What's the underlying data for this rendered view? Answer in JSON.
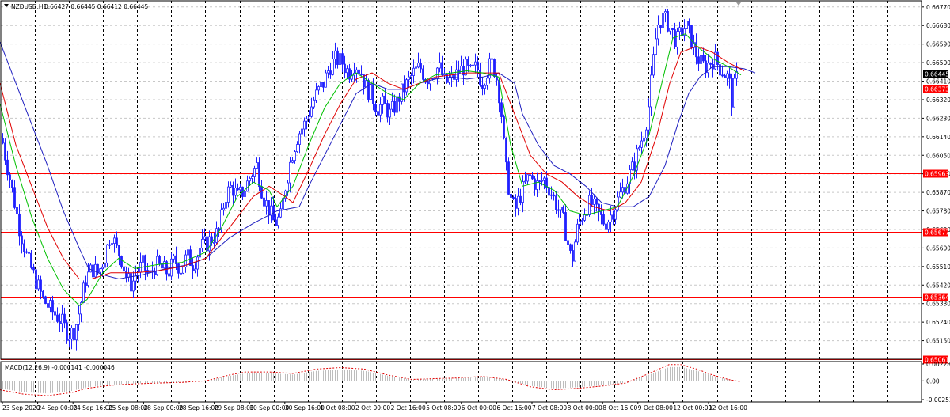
{
  "chart_data": {
    "type": "candlestick",
    "info": {
      "symbol_label": "NZDUSD,H1",
      "ohlc_text": "0.66427 0.66445 0.66412 0.66445"
    },
    "price_axis": {
      "min": 0.6506,
      "max": 0.668,
      "ticks": [
        "0.66770",
        "0.66680",
        "0.66590",
        "0.66500",
        "0.66410",
        "0.66320",
        "0.66230",
        "0.66140",
        "0.66050",
        "0.65960",
        "0.65870",
        "0.65780",
        "0.65690",
        "0.65600",
        "0.65510",
        "0.65420",
        "0.65330",
        "0.65240",
        "0.65150"
      ]
    },
    "time_labels": [
      "23 Sep 2020",
      "24 Sep 00:00",
      "24 Sep 16:00",
      "25 Sep 08:00",
      "28 Sep 00:00",
      "28 Sep 16:00",
      "29 Sep 08:00",
      "30 Sep 00:00",
      "30 Sep 16:00",
      "1 Oct 08:00",
      "2 Oct 00:00",
      "2 Oct 16:00",
      "5 Oct 08:00",
      "6 Oct 00:00",
      "6 Oct 16:00",
      "7 Oct 08:00",
      "8 Oct 00:00",
      "8 Oct 16:00",
      "9 Oct 08:00",
      "12 Oct 00:00",
      "12 Oct 16:00"
    ],
    "current_price": "0.66445",
    "horizontal_lines": [
      {
        "value": 0.66373,
        "label": "0.66373"
      },
      {
        "value": 0.65963,
        "label": "0.65963"
      },
      {
        "value": 0.65677,
        "label": "0.65677"
      },
      {
        "value": 0.65364,
        "label": "0.65364"
      },
      {
        "value": 0.65061,
        "label": "0.65061"
      }
    ],
    "price_path": [
      [
        0,
        0.6617
      ],
      [
        6,
        0.6605
      ],
      [
        14,
        0.659
      ],
      [
        24,
        0.657
      ],
      [
        34,
        0.6555
      ],
      [
        44,
        0.6545
      ],
      [
        54,
        0.6535
      ],
      [
        64,
        0.653
      ],
      [
        76,
        0.6525
      ],
      [
        86,
        0.6518
      ],
      [
        94,
        0.652
      ],
      [
        100,
        0.653
      ],
      [
        108,
        0.6545
      ],
      [
        116,
        0.655
      ],
      [
        124,
        0.6548
      ],
      [
        132,
        0.6556
      ],
      [
        140,
        0.6568
      ],
      [
        146,
        0.656
      ],
      [
        152,
        0.6556
      ],
      [
        160,
        0.6545
      ],
      [
        166,
        0.6542
      ],
      [
        172,
        0.6548
      ],
      [
        180,
        0.6552
      ],
      [
        188,
        0.6546
      ],
      [
        196,
        0.6552
      ],
      [
        204,
        0.655
      ],
      [
        212,
        0.6548
      ],
      [
        220,
        0.6554
      ],
      [
        228,
        0.655
      ],
      [
        236,
        0.6556
      ],
      [
        244,
        0.6552
      ],
      [
        252,
        0.656
      ],
      [
        260,
        0.6562
      ],
      [
        268,
        0.6565
      ],
      [
        276,
        0.6568
      ],
      [
        284,
        0.6585
      ],
      [
        292,
        0.659
      ],
      [
        300,
        0.6585
      ],
      [
        308,
        0.6588
      ],
      [
        316,
        0.6595
      ],
      [
        324,
        0.66
      ],
      [
        332,
        0.6585
      ],
      [
        340,
        0.6578
      ],
      [
        346,
        0.6572
      ],
      [
        354,
        0.6575
      ],
      [
        360,
        0.659
      ],
      [
        368,
        0.6605
      ],
      [
        376,
        0.6615
      ],
      [
        384,
        0.662
      ],
      [
        392,
        0.6628
      ],
      [
        400,
        0.6635
      ],
      [
        408,
        0.664
      ],
      [
        416,
        0.6648
      ],
      [
        424,
        0.6652
      ],
      [
        432,
        0.665
      ],
      [
        440,
        0.6645
      ],
      [
        448,
        0.665
      ],
      [
        456,
        0.6645
      ],
      [
        462,
        0.6638
      ],
      [
        468,
        0.6635
      ],
      [
        476,
        0.6628
      ],
      [
        484,
        0.663
      ],
      [
        492,
        0.6625
      ],
      [
        500,
        0.663
      ],
      [
        506,
        0.6635
      ],
      [
        514,
        0.664
      ],
      [
        522,
        0.6645
      ],
      [
        530,
        0.6648
      ],
      [
        538,
        0.6642
      ],
      [
        546,
        0.6645
      ],
      [
        554,
        0.6648
      ],
      [
        562,
        0.664
      ],
      [
        570,
        0.6642
      ],
      [
        578,
        0.6645
      ],
      [
        586,
        0.6648
      ],
      [
        594,
        0.6645
      ],
      [
        602,
        0.6648
      ],
      [
        608,
        0.664
      ],
      [
        614,
        0.6645
      ],
      [
        620,
        0.665
      ],
      [
        626,
        0.6645
      ],
      [
        632,
        0.663
      ],
      [
        638,
        0.66
      ],
      [
        644,
        0.6585
      ],
      [
        650,
        0.6578
      ],
      [
        656,
        0.6585
      ],
      [
        662,
        0.659
      ],
      [
        668,
        0.6595
      ],
      [
        674,
        0.6592
      ],
      [
        680,
        0.659
      ],
      [
        686,
        0.6594
      ],
      [
        692,
        0.659
      ],
      [
        698,
        0.6585
      ],
      [
        706,
        0.6578
      ],
      [
        712,
        0.6572
      ],
      [
        718,
        0.656
      ],
      [
        722,
        0.6553
      ],
      [
        728,
        0.6568
      ],
      [
        734,
        0.6575
      ],
      [
        740,
        0.658
      ],
      [
        746,
        0.6582
      ],
      [
        752,
        0.6578
      ],
      [
        758,
        0.6575
      ],
      [
        764,
        0.6572
      ],
      [
        770,
        0.6575
      ],
      [
        776,
        0.658
      ],
      [
        782,
        0.6585
      ],
      [
        788,
        0.659
      ],
      [
        794,
        0.6595
      ],
      [
        800,
        0.66
      ],
      [
        806,
        0.6608
      ],
      [
        812,
        0.6615
      ],
      [
        818,
        0.6625
      ],
      [
        822,
        0.664
      ],
      [
        826,
        0.6655
      ],
      [
        830,
        0.6668
      ],
      [
        836,
        0.6672
      ],
      [
        842,
        0.667
      ],
      [
        848,
        0.6665
      ],
      [
        854,
        0.666
      ],
      [
        860,
        0.6665
      ],
      [
        866,
        0.6668
      ],
      [
        872,
        0.6662
      ],
      [
        878,
        0.6655
      ],
      [
        884,
        0.665
      ],
      [
        890,
        0.6648
      ],
      [
        896,
        0.665
      ],
      [
        902,
        0.6652
      ],
      [
        908,
        0.6648
      ],
      [
        914,
        0.6645
      ],
      [
        920,
        0.6642
      ],
      [
        924,
        0.6632
      ],
      [
        928,
        0.664
      ],
      [
        932,
        0.6645
      ]
    ],
    "sma_blue": [
      [
        0,
        0.666
      ],
      [
        10,
        0.665
      ],
      [
        20,
        0.664
      ],
      [
        40,
        0.662
      ],
      [
        60,
        0.66
      ],
      [
        80,
        0.6578
      ],
      [
        100,
        0.656
      ],
      [
        112,
        0.655
      ],
      [
        130,
        0.6547
      ],
      [
        150,
        0.6545
      ],
      [
        180,
        0.6547
      ],
      [
        210,
        0.655
      ],
      [
        240,
        0.6552
      ],
      [
        260,
        0.6555
      ],
      [
        290,
        0.6565
      ],
      [
        320,
        0.6572
      ],
      [
        350,
        0.6578
      ],
      [
        378,
        0.658
      ],
      [
        390,
        0.659
      ],
      [
        410,
        0.6605
      ],
      [
        430,
        0.662
      ],
      [
        450,
        0.6635
      ],
      [
        470,
        0.664
      ],
      [
        490,
        0.6637
      ],
      [
        510,
        0.6637
      ],
      [
        530,
        0.664
      ],
      [
        550,
        0.6642
      ],
      [
        570,
        0.6643
      ],
      [
        590,
        0.6642
      ],
      [
        610,
        0.6643
      ],
      [
        630,
        0.6645
      ],
      [
        650,
        0.664
      ],
      [
        660,
        0.6625
      ],
      [
        680,
        0.661
      ],
      [
        700,
        0.66
      ],
      [
        720,
        0.6596
      ],
      [
        740,
        0.659
      ],
      [
        760,
        0.6582
      ],
      [
        780,
        0.658
      ],
      [
        800,
        0.658
      ],
      [
        820,
        0.6585
      ],
      [
        840,
        0.66
      ],
      [
        856,
        0.662
      ],
      [
        870,
        0.6635
      ],
      [
        884,
        0.6643
      ],
      [
        900,
        0.6648
      ],
      [
        920,
        0.6648
      ],
      [
        940,
        0.6647
      ],
      [
        954,
        0.6645
      ]
    ],
    "ema_red": [
      [
        0,
        0.664
      ],
      [
        20,
        0.661
      ],
      [
        40,
        0.659
      ],
      [
        60,
        0.657
      ],
      [
        80,
        0.6555
      ],
      [
        100,
        0.6545
      ],
      [
        116,
        0.6545
      ],
      [
        140,
        0.6548
      ],
      [
        170,
        0.6548
      ],
      [
        200,
        0.6549
      ],
      [
        230,
        0.6551
      ],
      [
        260,
        0.6555
      ],
      [
        280,
        0.6565
      ],
      [
        300,
        0.6575
      ],
      [
        320,
        0.6585
      ],
      [
        340,
        0.659
      ],
      [
        360,
        0.6585
      ],
      [
        370,
        0.6582
      ],
      [
        390,
        0.6598
      ],
      [
        410,
        0.6615
      ],
      [
        430,
        0.663
      ],
      [
        450,
        0.6642
      ],
      [
        470,
        0.6645
      ],
      [
        490,
        0.664
      ],
      [
        510,
        0.6637
      ],
      [
        530,
        0.664
      ],
      [
        550,
        0.6643
      ],
      [
        570,
        0.6644
      ],
      [
        590,
        0.6645
      ],
      [
        610,
        0.6645
      ],
      [
        630,
        0.6645
      ],
      [
        650,
        0.6625
      ],
      [
        670,
        0.6605
      ],
      [
        690,
        0.6596
      ],
      [
        710,
        0.6592
      ],
      [
        730,
        0.6585
      ],
      [
        750,
        0.658
      ],
      [
        770,
        0.6578
      ],
      [
        790,
        0.6582
      ],
      [
        810,
        0.6592
      ],
      [
        830,
        0.6615
      ],
      [
        846,
        0.664
      ],
      [
        860,
        0.6655
      ],
      [
        880,
        0.6658
      ],
      [
        900,
        0.6655
      ],
      [
        920,
        0.665
      ],
      [
        940,
        0.6646
      ]
    ],
    "ema_green": [
      [
        0,
        0.663
      ],
      [
        20,
        0.66
      ],
      [
        40,
        0.6575
      ],
      [
        60,
        0.6555
      ],
      [
        80,
        0.654
      ],
      [
        100,
        0.6532
      ],
      [
        110,
        0.6535
      ],
      [
        130,
        0.6548
      ],
      [
        150,
        0.6555
      ],
      [
        170,
        0.655
      ],
      [
        200,
        0.6552
      ],
      [
        230,
        0.6553
      ],
      [
        260,
        0.6558
      ],
      [
        280,
        0.657
      ],
      [
        300,
        0.6585
      ],
      [
        320,
        0.6592
      ],
      [
        340,
        0.6588
      ],
      [
        350,
        0.658
      ],
      [
        370,
        0.659
      ],
      [
        390,
        0.661
      ],
      [
        410,
        0.6628
      ],
      [
        430,
        0.664
      ],
      [
        450,
        0.6645
      ],
      [
        470,
        0.664
      ],
      [
        490,
        0.6635
      ],
      [
        510,
        0.6632
      ],
      [
        530,
        0.664
      ],
      [
        550,
        0.6644
      ],
      [
        570,
        0.6645
      ],
      [
        590,
        0.6646
      ],
      [
        610,
        0.6645
      ],
      [
        630,
        0.6643
      ],
      [
        645,
        0.661
      ],
      [
        660,
        0.659
      ],
      [
        680,
        0.6592
      ],
      [
        700,
        0.6588
      ],
      [
        720,
        0.6578
      ],
      [
        740,
        0.6576
      ],
      [
        760,
        0.6578
      ],
      [
        780,
        0.658
      ],
      [
        800,
        0.6595
      ],
      [
        820,
        0.6615
      ],
      [
        836,
        0.664
      ],
      [
        850,
        0.6662
      ],
      [
        866,
        0.6664
      ],
      [
        880,
        0.6658
      ],
      [
        900,
        0.6652
      ],
      [
        920,
        0.6648
      ],
      [
        936,
        0.6644
      ]
    ],
    "macd": {
      "label": "MACD(12,26,9) -0.000141 -0.000046",
      "ticks": [
        "0.002282",
        "0.00",
        "-0.002531"
      ],
      "signal": [
        [
          0,
          -0.0012
        ],
        [
          30,
          -0.0018
        ],
        [
          60,
          -0.002
        ],
        [
          90,
          -0.0016
        ],
        [
          110,
          -0.001
        ],
        [
          140,
          -0.0006
        ],
        [
          170,
          -0.0004
        ],
        [
          200,
          -0.0003
        ],
        [
          230,
          -0.0002
        ],
        [
          260,
          0.0
        ],
        [
          290,
          0.0008
        ],
        [
          310,
          0.0012
        ],
        [
          340,
          0.0012
        ],
        [
          370,
          0.001
        ],
        [
          400,
          0.0016
        ],
        [
          430,
          0.0018
        ],
        [
          460,
          0.0016
        ],
        [
          490,
          0.0008
        ],
        [
          520,
          0.0002
        ],
        [
          550,
          0.0003
        ],
        [
          580,
          0.0004
        ],
        [
          610,
          0.0006
        ],
        [
          640,
          0.0002
        ],
        [
          670,
          -0.0008
        ],
        [
          700,
          -0.0012
        ],
        [
          730,
          -0.001
        ],
        [
          760,
          -0.0007
        ],
        [
          790,
          -0.0003
        ],
        [
          820,
          0.001
        ],
        [
          845,
          0.0022
        ],
        [
          860,
          0.0022
        ],
        [
          880,
          0.0016
        ],
        [
          900,
          0.0008
        ],
        [
          920,
          0.0002
        ],
        [
          935,
          -0.0001
        ]
      ]
    }
  }
}
